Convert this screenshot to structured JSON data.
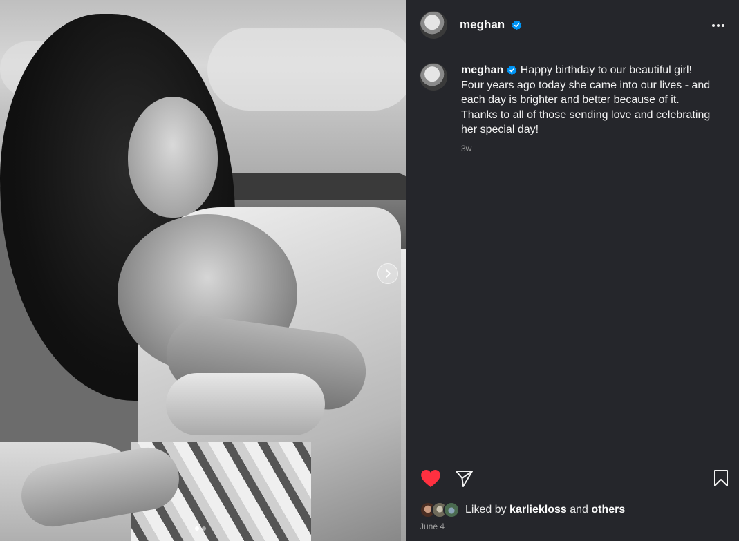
{
  "post": {
    "username": "meghan",
    "verified": true,
    "caption": "Happy birthday to our beautiful girl! Four years ago today she came into our lives - and each day is brighter and better because of it. Thanks to all of those sending love and celebrating her special day!",
    "time_ago": "3w",
    "date": "June 4",
    "liked_by_prefix": "Liked by",
    "liked_by_user": "karliekloss",
    "liked_by_and": "and",
    "liked_by_others": "others",
    "liked": true,
    "carousel_current": 1,
    "carousel_total": 2
  },
  "colors": {
    "background": "#25262b",
    "like_red": "#ff3040",
    "verified_blue": "#0095f6"
  },
  "icons": {
    "like": "heart-filled-icon",
    "share": "paper-plane-icon",
    "save": "bookmark-icon",
    "more": "more-horizontal-icon",
    "next": "chevron-right-icon",
    "verified": "verified-badge-icon"
  }
}
